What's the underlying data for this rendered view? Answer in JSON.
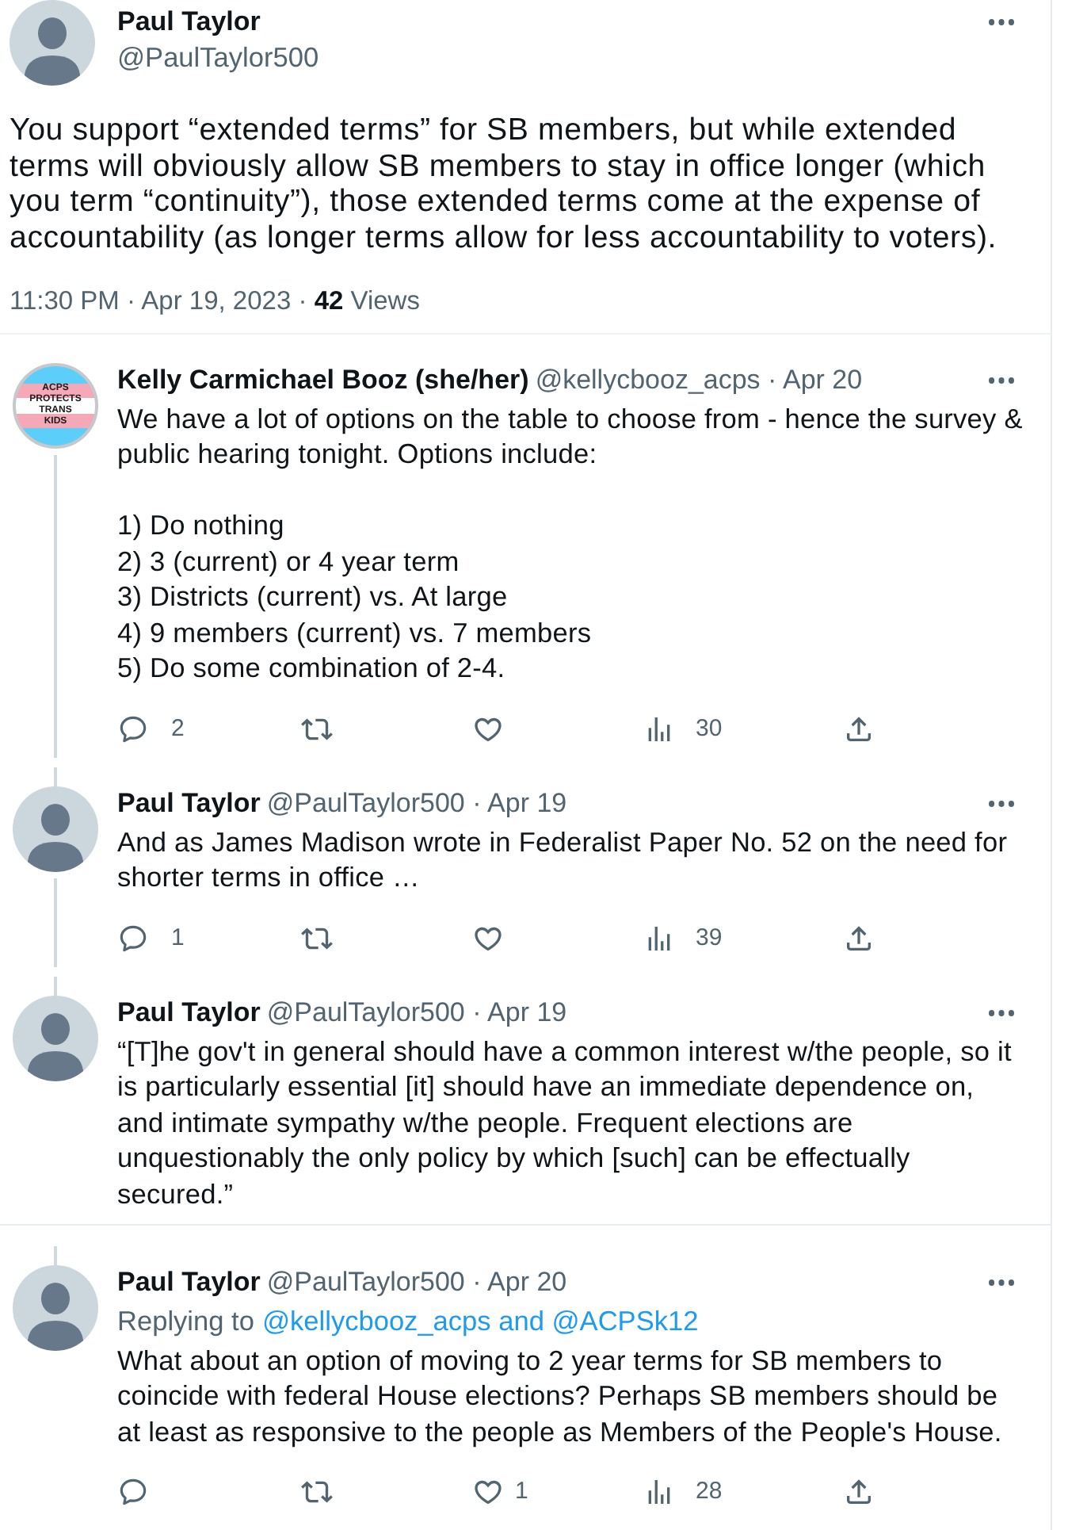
{
  "main_post": {
    "name": "Paul Taylor",
    "handle": "@PaulTaylor500",
    "avatar": {
      "kind": "default"
    },
    "text": "You support “extended terms” for SB members, but while extended terms will obviously allow SB members to stay in office longer (which you term “continuity”), those extended terms come at the expense of accountability (as longer terms allow for less accountability to voters).",
    "timestamp": "11:30 PM · Apr 19, 2023 · **42** Views"
  },
  "replies": [
    {
      "name": "Kelly Carmichael Booz (she/her)",
      "byline": "@kellycbooz_acps · Apr 20",
      "avatar": {
        "kind": "flag",
        "label_lines": [
          "ACPS",
          "PROTECTS",
          "TRANS",
          "KIDS"
        ]
      },
      "connected_above": false,
      "connected_below": true,
      "text": "We have a lot of options on the table to choose from - hence the survey & public hearing tonight. Options include:\n\n1) Do nothing\n2) 3 (current) or 4 year term\n3) Districts (current) vs. At large\n4) 9 members (current) vs. 7 members\n5) Do some combination of 2-4.",
      "actions": [
        {
          "kind": "reply",
          "count": "2"
        },
        {
          "kind": "repost"
        },
        {
          "kind": "like"
        },
        {
          "kind": "views",
          "count": "30"
        },
        {
          "kind": "share"
        }
      ]
    },
    {
      "name": "Paul Taylor",
      "byline": "@PaulTaylor500 · Apr 19",
      "avatar": {
        "kind": "default"
      },
      "connected_above": true,
      "connected_below": true,
      "text": "And as James Madison wrote in Federalist Paper No. 52 on the need for shorter terms in office …",
      "actions": [
        {
          "kind": "reply",
          "count": "1"
        },
        {
          "kind": "repost"
        },
        {
          "kind": "like"
        },
        {
          "kind": "views",
          "count": "39"
        },
        {
          "kind": "share"
        }
      ]
    },
    {
      "name": "Paul Taylor",
      "byline": "@PaulTaylor500 · Apr 19",
      "avatar": {
        "kind": "default"
      },
      "connected_above": true,
      "connected_below": false,
      "text": "“[T]he gov't in general should have a common interest w/the people, so it is particularly essential [it] should have an immediate dependence on, and intimate sympathy w/the people. Frequent elections are unquestionably the only policy by which [such] can be effectually secured.”"
    },
    {
      "name": "Paul Taylor",
      "byline": "@PaulTaylor500 · Apr 20",
      "avatar": {
        "kind": "default"
      },
      "connected_above": true,
      "connected_below": false,
      "replying_to": {
        "prefix": "Replying to",
        "mentions": "@kellycbooz_acps and @ACPSk12"
      },
      "text": "What about an option of moving to 2 year terms for SB members to coincide with federal House elections? Perhaps SB members should be at least as responsive to the people as Members of the People's House.",
      "actions": [
        {
          "kind": "reply"
        },
        {
          "kind": "repost"
        },
        {
          "kind": "like",
          "count": "1"
        },
        {
          "kind": "views",
          "count": "28"
        },
        {
          "kind": "share"
        }
      ]
    }
  ]
}
